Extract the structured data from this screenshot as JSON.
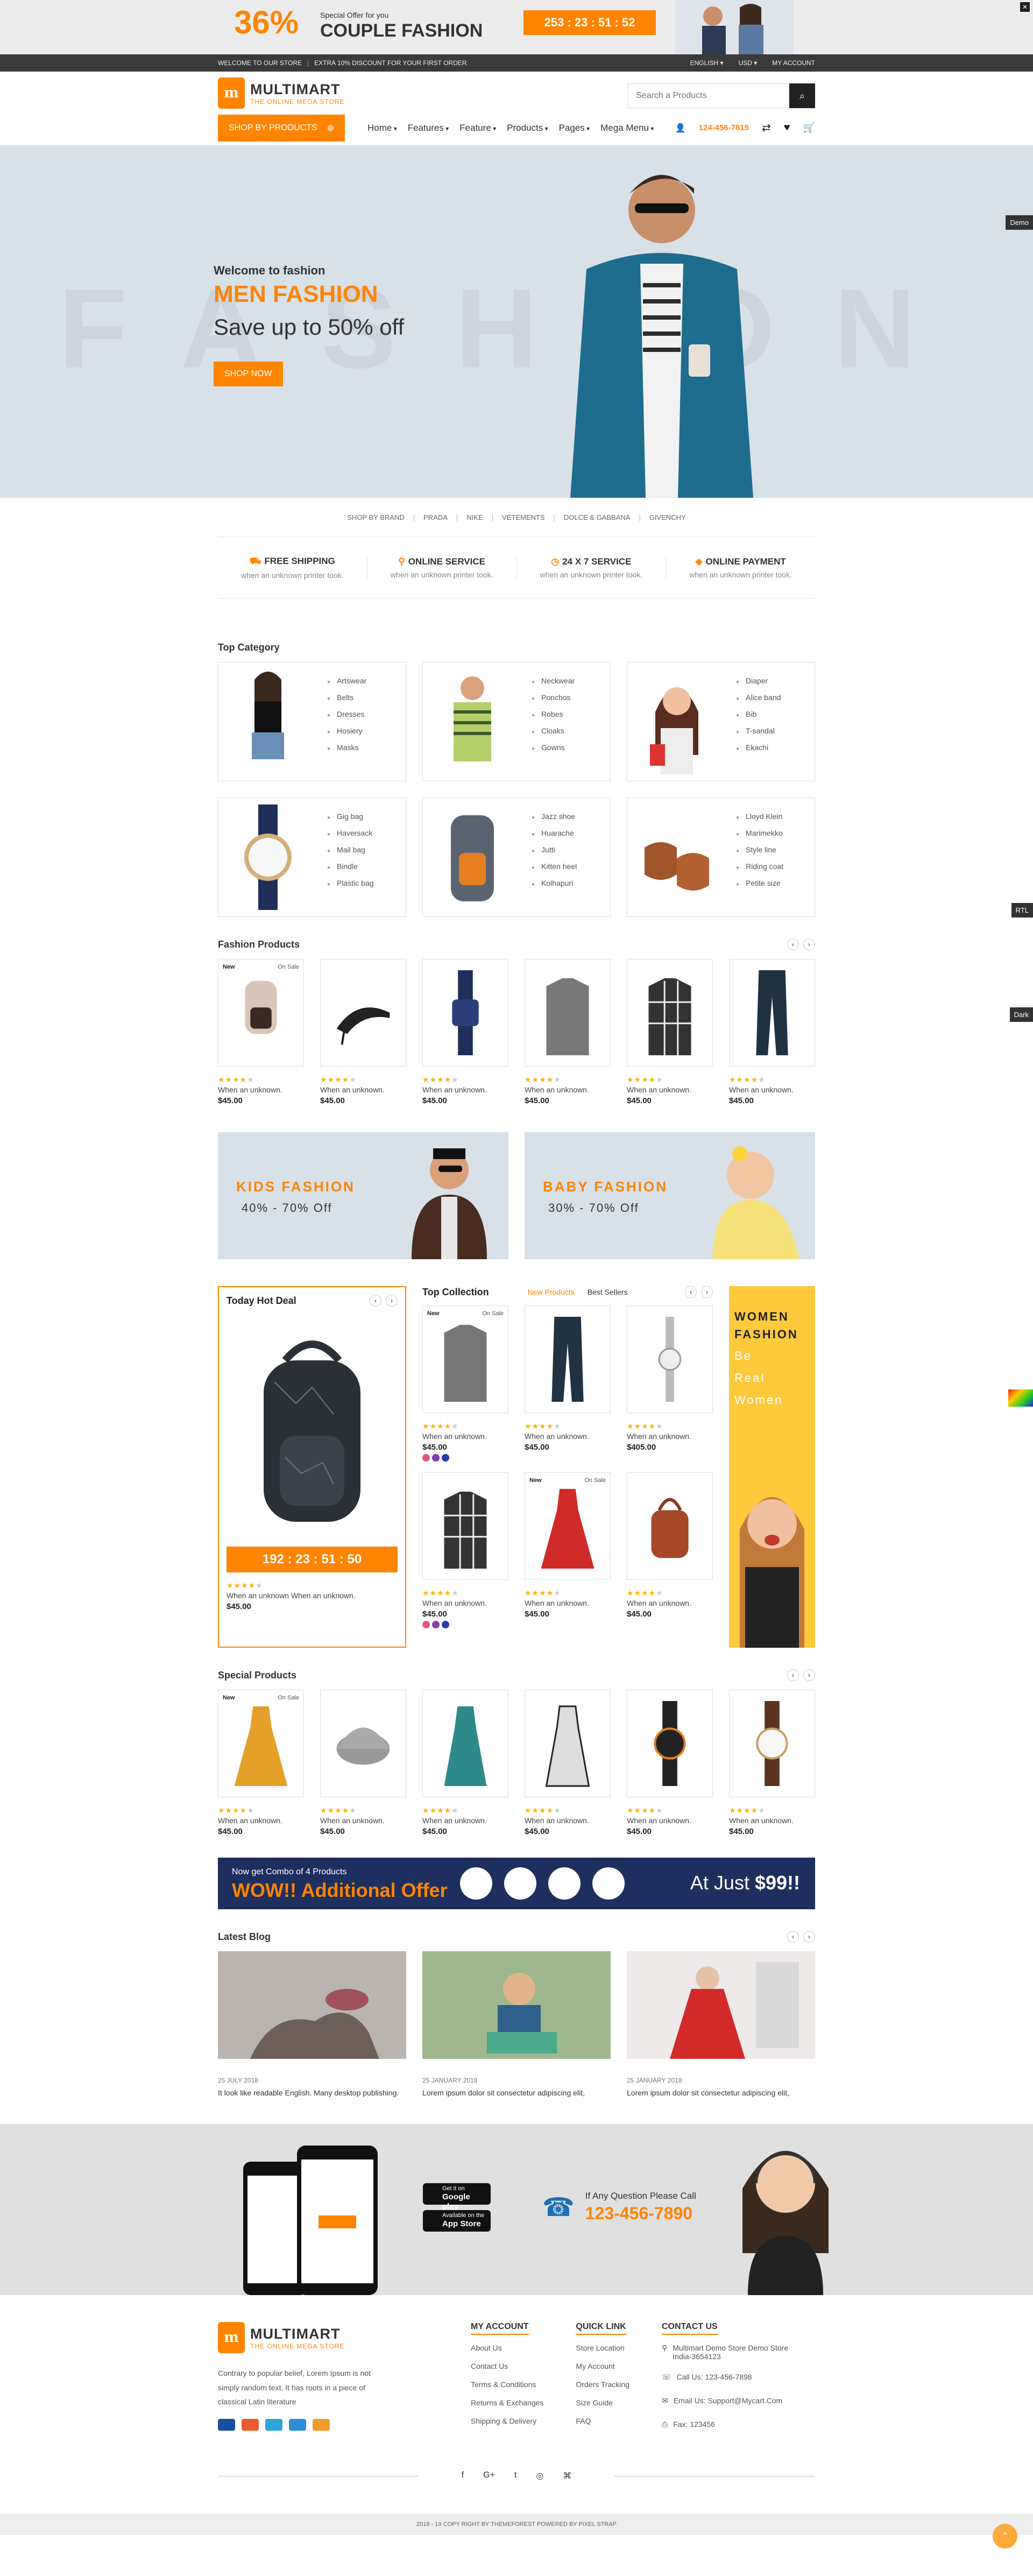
{
  "promo": {
    "percent": "36%",
    "small": "Special Offer for you",
    "big": "COUPLE FASHION",
    "timer": "253 : 23 : 51 : 52",
    "close": "✕"
  },
  "topbar": {
    "welcome": "Welcome to our store",
    "sep": "|",
    "offer": "Extra 10% discount for your first order",
    "language": "English ▾",
    "currency": "USD ▾",
    "account": "My Account"
  },
  "header": {
    "logo_letter": "m",
    "logo_name": "MULTIMART",
    "logo_tagline": "THE ONLINE MEGA STORE",
    "search_placeholder": "Search a Products",
    "search_icon": "⌕"
  },
  "nav": {
    "category_button": "Shop by products",
    "category_icon": "⊕",
    "menu": [
      "Home",
      "Features",
      "Feature",
      "Products",
      "Pages",
      "Mega Menu"
    ],
    "phone": "124-456-7815",
    "user_icon": "👤",
    "compare_icon": "⇄",
    "wish_icon": "♥",
    "cart_icon": "🛒"
  },
  "hero": {
    "bg_word": "FASHION",
    "welcome": "Welcome to fashion",
    "title": "MEN FASHION",
    "subtitle": "Save up to 50% off",
    "button": "Shop now"
  },
  "side_tabs": {
    "demo": "Demo",
    "rtl": "RTL",
    "dark": "Dark"
  },
  "brands": [
    "Shop by brand",
    "Prada",
    "Nike",
    "Vetements",
    "Dolce & Gabbana",
    "Givenchy"
  ],
  "services": [
    {
      "icon": "⛟",
      "title": "Free Shipping",
      "sub": "when an unknown printer took."
    },
    {
      "icon": "⚲",
      "title": "Online Service",
      "sub": "when an unknown printer took."
    },
    {
      "icon": "◷",
      "title": "24 X 7 Service",
      "sub": "when an unknown printer took."
    },
    {
      "icon": "◈",
      "title": "Online Payment",
      "sub": "when an unknown printer took."
    }
  ],
  "top_category": {
    "title": "Top Category",
    "cards": [
      [
        "Artswear",
        "Belts",
        "Dresses",
        "Hosiery",
        "Masks"
      ],
      [
        "Neckwear",
        "Ponchos",
        "Robes",
        "Cloaks",
        "Gowns"
      ],
      [
        "Diaper",
        "Alice band",
        "Bib",
        "T-sandal",
        "Ekachi"
      ],
      [
        "Gig bag",
        "Haversack",
        "Mail bag",
        "Bindle",
        "Plastic bag"
      ],
      [
        "Jazz shoe",
        "Huarache",
        "Jutti",
        "Kitten heel",
        "Kolhapuri"
      ],
      [
        "Lloyd Klein",
        "Marimekko",
        "Style line",
        "Riding coat",
        "Petite size"
      ]
    ]
  },
  "fashion_products": {
    "title": "Fashion Products",
    "prev": "‹",
    "next": "›",
    "items": [
      {
        "new": "New",
        "sale": "On Sale",
        "desc": "When an unknown.",
        "price": "$45.00"
      },
      {
        "new": "",
        "sale": "",
        "desc": "When an unknown.",
        "price": "$45.00"
      },
      {
        "new": "",
        "sale": "",
        "desc": "When an unknown.",
        "price": "$45.00"
      },
      {
        "new": "",
        "sale": "",
        "desc": "When an unknown.",
        "price": "$45.00"
      },
      {
        "new": "",
        "sale": "",
        "desc": "When an unknown.",
        "price": "$45.00"
      },
      {
        "new": "",
        "sale": "",
        "desc": "When an unknown.",
        "price": "$45.00"
      }
    ]
  },
  "banners": [
    {
      "title": "KIDS FASHION",
      "sub": "40% - 70% Off"
    },
    {
      "title": "BABY FASHION",
      "sub": "30% - 70% Off"
    }
  ],
  "hot_deal": {
    "title": "Today Hot Deal",
    "timer": "192 : 23 : 51 : 50",
    "desc": "When an unknown When an unknown.",
    "price": "$45.00"
  },
  "top_collection": {
    "title": "Top Collection",
    "tabs": [
      "New Products",
      "Best Sellers"
    ],
    "items": [
      {
        "new": "New",
        "sale": "On Sale",
        "desc": "When an unknown.",
        "price": "$45.00",
        "swatches": true
      },
      {
        "new": "",
        "sale": "",
        "desc": "When an unknown.",
        "price": "$45.00",
        "swatches": false
      },
      {
        "new": "",
        "sale": "",
        "desc": "When an unknown.",
        "price": "$405.00",
        "swatches": false
      },
      {
        "new": "",
        "sale": "",
        "desc": "When an unknown.",
        "price": "$45.00",
        "swatches": true
      },
      {
        "new": "New",
        "sale": "On Sale",
        "desc": "When an unknown.",
        "price": "$45.00",
        "swatches": false
      },
      {
        "new": "",
        "sale": "",
        "desc": "When an unknown.",
        "price": "$45.00",
        "swatches": false
      }
    ]
  },
  "women_banner": {
    "title1": "WOMEN",
    "title2": "FASHION",
    "sub1": "Be",
    "sub2": "Real",
    "sub3": "Women"
  },
  "special_products": {
    "title": "Special Products",
    "items": [
      {
        "new": "New",
        "sale": "On Sale",
        "desc": "When an unknown.",
        "price": "$45.00"
      },
      {
        "new": "",
        "sale": "",
        "desc": "When an unknown.",
        "price": "$45.00"
      },
      {
        "new": "",
        "sale": "",
        "desc": "When an unknown.",
        "price": "$45.00"
      },
      {
        "new": "",
        "sale": "",
        "desc": "When an unknown.",
        "price": "$45.00"
      },
      {
        "new": "",
        "sale": "",
        "desc": "When an unknown.",
        "price": "$45.00"
      },
      {
        "new": "",
        "sale": "",
        "desc": "When an unknown.",
        "price": "$45.00"
      }
    ]
  },
  "combo": {
    "small": "Now get Combo of 4 Products",
    "big": "WOW!! Additional Offer",
    "price_prefix": "At Just ",
    "price": "$99!!"
  },
  "blog": {
    "title": "Latest Blog",
    "posts": [
      {
        "date": "25 JULY 2018",
        "text": "It look like readable English. Many desktop publishing."
      },
      {
        "date": "25 JANUARY 2018",
        "text": "Lorem ipsum dolor sit consectetur adipiscing elit,"
      },
      {
        "date": "25 JANUARY 2018",
        "text": "Lorem ipsum dolor sit consectetur adipiscing elit,"
      }
    ]
  },
  "app_band": {
    "gp_small": "Get it on",
    "gp_big": "Google play",
    "as_small": "Available on the",
    "as_big": "App Store",
    "call_text": "If Any Question Please Call",
    "phone": "123-456-7890"
  },
  "footer": {
    "about": "Contrary to popular belief, Lorem Ipsum is not simply random text. It has roots in a piece of classical Latin literature",
    "my_account": {
      "title": "My Account",
      "links": [
        "About Us",
        "Contact Us",
        "Terms & Conditions",
        "Returns & Exchanges",
        "Shipping & Delivery"
      ]
    },
    "quick_link": {
      "title": "Quick Link",
      "links": [
        "Store Location",
        "My Account",
        "Orders Tracking",
        "Size Guide",
        "FAQ"
      ]
    },
    "contact": {
      "title": "Contact Us",
      "address": "Multimart Demo Store Demo Store India-3654123",
      "call": "Call Us: 123-456-7898",
      "email": "Email Us: Support@Mycart.Com",
      "fax": "Fax: 123456"
    },
    "social_icons": [
      "f",
      "G+",
      "t",
      "◎",
      "⌘"
    ],
    "copyright": "2018 - 19 copy right by themeforest powered by pixel strap"
  },
  "colors": {
    "accent": "#ff8400",
    "dark": "#3a3a3a",
    "hero_bg": "#d8e0e8",
    "combo_bg": "#1d2f5e",
    "women_bg": "#ffc93c"
  }
}
